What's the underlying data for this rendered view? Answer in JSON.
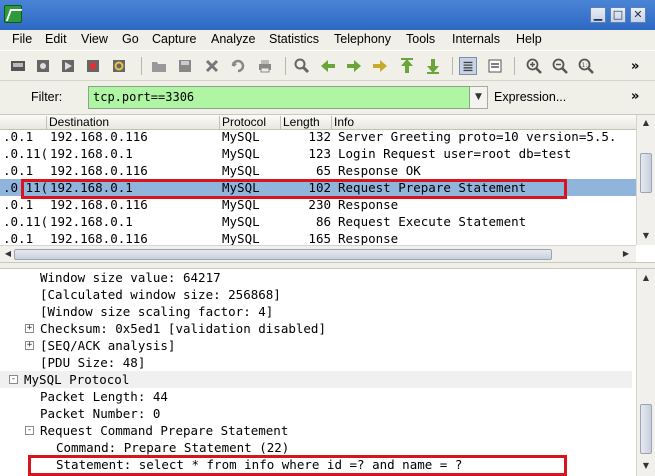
{
  "menu": [
    "File",
    "Edit",
    "View",
    "Go",
    "Capture",
    "Analyze",
    "Statistics",
    "Telephony",
    "Tools",
    "Internals",
    "Help"
  ],
  "window_buttons": {
    "minimize": "▁",
    "maximize": "□",
    "close": "✕"
  },
  "filter": {
    "label": "Filter:",
    "value": "tcp.port==3306",
    "expression_label": "Expression...",
    "dropdown_icon": "chevron-down-icon"
  },
  "toolbar_chevron": "»",
  "packet_list": {
    "columns": [
      "Destination",
      "Protocol",
      "Length",
      "Info"
    ],
    "rows": [
      {
        "source": ".0.1",
        "destination": "192.168.0.116",
        "protocol": "MySQL",
        "length": "132",
        "info": "Server Greeting proto=10 version=5.5."
      },
      {
        "source": ".0.11(",
        "destination": "192.168.0.1",
        "protocol": "MySQL",
        "length": "123",
        "info": "Login Request user=root db=test"
      },
      {
        "source": ".0.1",
        "destination": "192.168.0.116",
        "protocol": "MySQL",
        "length": "65",
        "info": "Response OK"
      },
      {
        "source": ".0.11(",
        "destination": "192.168.0.1",
        "protocol": "MySQL",
        "length": "102",
        "info": "Request Prepare Statement"
      },
      {
        "source": ".0.1",
        "destination": "192.168.0.116",
        "protocol": "MySQL",
        "length": "230",
        "info": "Response"
      },
      {
        "source": ".0.11(",
        "destination": "192.168.0.1",
        "protocol": "MySQL",
        "length": "86",
        "info": "Request Execute Statement"
      },
      {
        "source": ".0.1",
        "destination": "192.168.0.116",
        "protocol": "MySQL",
        "length": "165",
        "info": "Response"
      }
    ],
    "selected_index": 3
  },
  "details": [
    {
      "text": "Window size value: 64217",
      "expander": ""
    },
    {
      "text": "[Calculated window size: 256868]",
      "expander": ""
    },
    {
      "text": "[Window size scaling factor: 4]",
      "expander": ""
    },
    {
      "text": "Checksum: 0x5ed1 [validation disabled]",
      "expander": "+"
    },
    {
      "text": "[SEQ/ACK analysis]",
      "expander": "+"
    },
    {
      "text": "[PDU Size: 48]",
      "expander": ""
    },
    {
      "text": "MySQL Protocol",
      "expander": "-"
    },
    {
      "text": "Packet Length: 44",
      "expander": ""
    },
    {
      "text": "Packet Number: 0",
      "expander": ""
    },
    {
      "text": "Request Command Prepare Statement",
      "expander": "-"
    },
    {
      "text": "Command: Prepare Statement (22)",
      "expander": ""
    },
    {
      "text": "Statement: select * from info where id =? and name = ?",
      "expander": ""
    }
  ],
  "colors": {
    "selected_row": "#8fb5dd",
    "filter_bg": "#aff5a4",
    "highlight": "#d9141e"
  }
}
